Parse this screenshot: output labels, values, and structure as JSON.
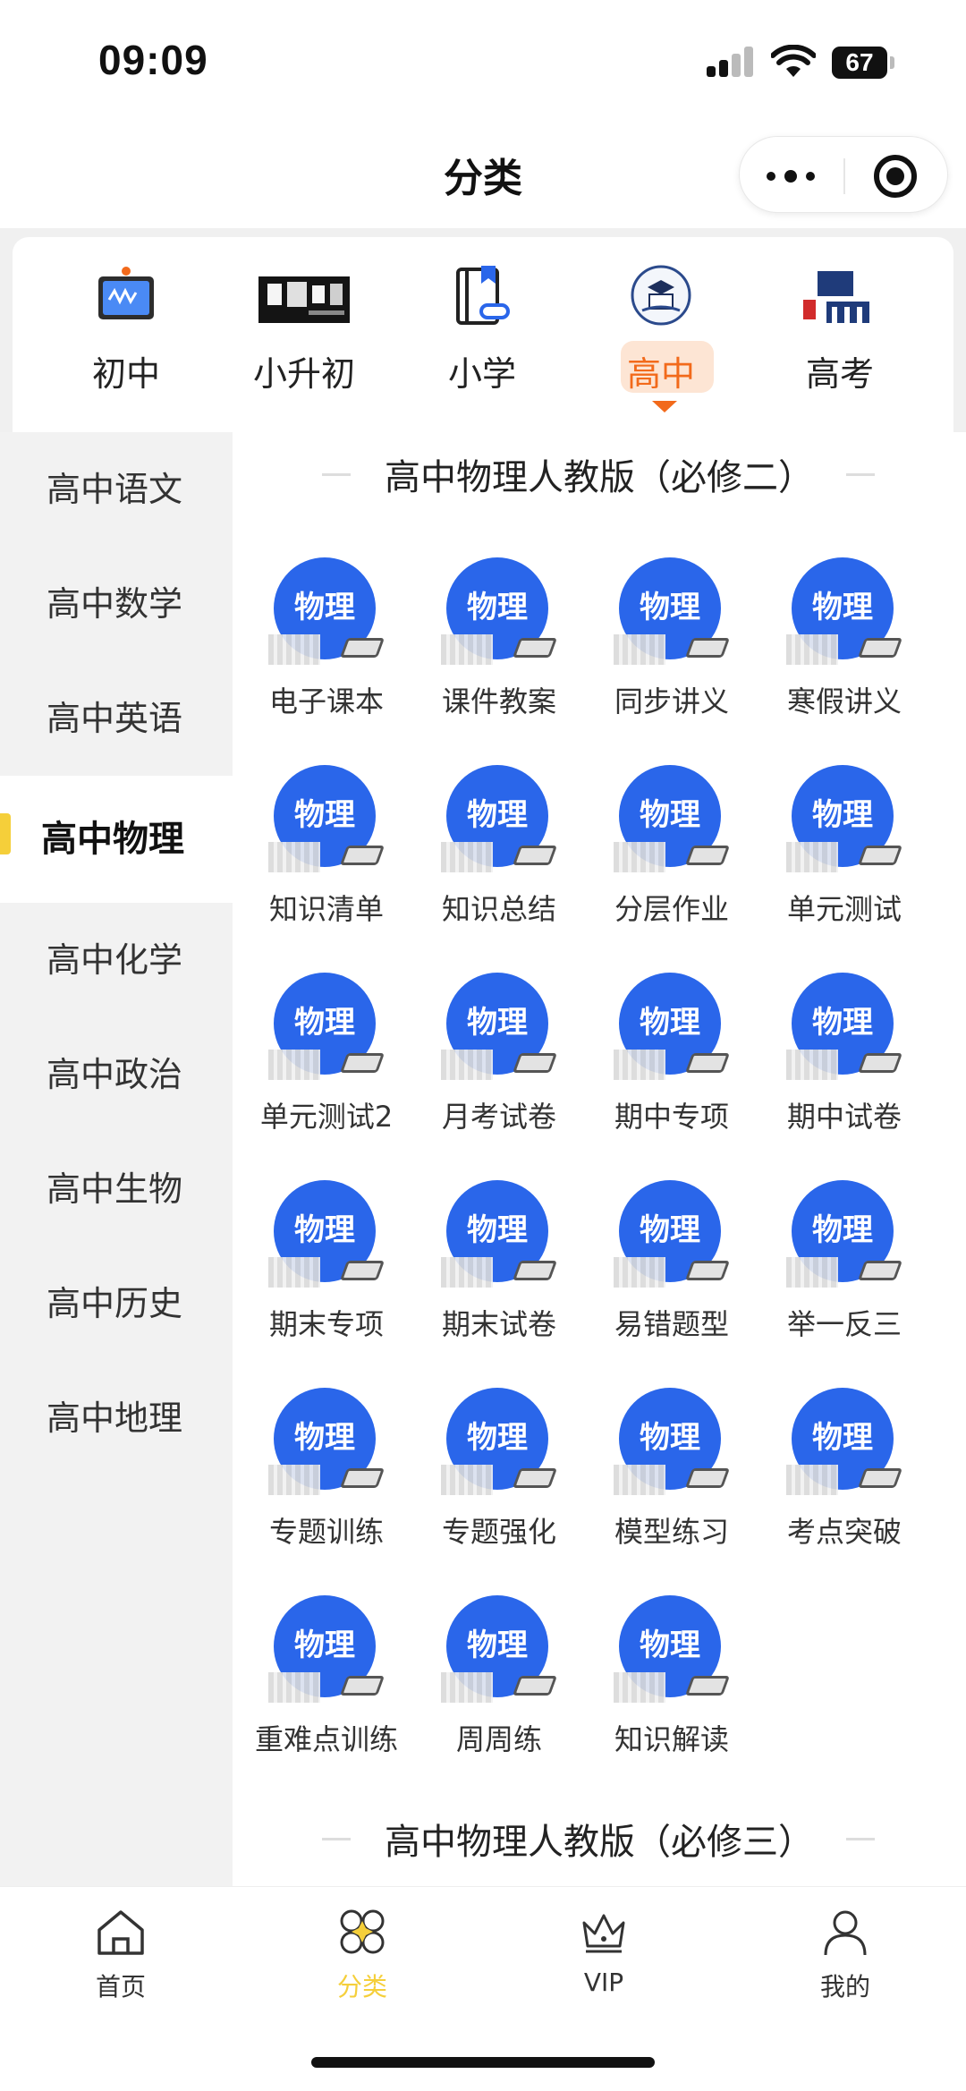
{
  "status": {
    "time": "09:09",
    "battery": "67"
  },
  "nav": {
    "title": "分类"
  },
  "levels": [
    {
      "label": "初中",
      "icon": "whiteboard-icon"
    },
    {
      "label": "小升初",
      "icon": "banner-image-icon"
    },
    {
      "label": "小学",
      "icon": "bookmark-book-icon"
    },
    {
      "label": "高中",
      "icon": "high-school-emblem-icon",
      "active": true
    },
    {
      "label": "高考",
      "icon": "gaokao-icon"
    }
  ],
  "sidebar": {
    "items": [
      "高中语文",
      "高中数学",
      "高中英语",
      "高中物理",
      "高中化学",
      "高中政治",
      "高中生物",
      "高中历史",
      "高中地理"
    ],
    "active_index": 3
  },
  "content": {
    "sections": [
      {
        "title": "高中物理人教版（必修二）",
        "items": [
          "电子课本",
          "课件教案",
          "同步讲义",
          "寒假讲义",
          "知识清单",
          "知识总结",
          "分层作业",
          "单元测试",
          "单元测试2",
          "月考试卷",
          "期中专项",
          "期中试卷",
          "期末专项",
          "期末试卷",
          "易错题型",
          "举一反三",
          "专题训练",
          "专题强化",
          "模型练习",
          "考点突破",
          "重难点训练",
          "周周练",
          "知识解读"
        ]
      },
      {
        "title": "高中物理人教版（必修三）",
        "items": []
      }
    ],
    "icon_text": "物理",
    "badge_color": "#2a66ea"
  },
  "tabbar": [
    {
      "label": "首页",
      "icon": "home-icon"
    },
    {
      "label": "分类",
      "icon": "category-icon",
      "active": true
    },
    {
      "label": "VIP",
      "icon": "crown-icon"
    },
    {
      "label": "我的",
      "icon": "profile-icon"
    }
  ],
  "colors": {
    "accent_orange": "#f26a1b",
    "accent_yellow": "#f5cf3a"
  }
}
